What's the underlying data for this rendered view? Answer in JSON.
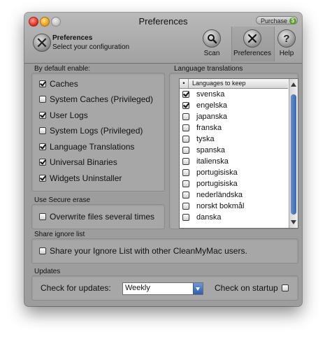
{
  "window": {
    "title": "Preferences",
    "purchase_label": "Purchase",
    "purchase_badge": "$"
  },
  "header": {
    "title": "Preferences",
    "subtitle": "Select your configuration"
  },
  "toolbar": {
    "scan_label": "Scan",
    "preferences_label": "Preferences",
    "help_label": "Help"
  },
  "defaults": {
    "heading": "By default enable:",
    "options": [
      {
        "label": "Caches",
        "checked": true
      },
      {
        "label": "System Caches (Privileged)",
        "checked": false
      },
      {
        "label": "User Logs",
        "checked": true
      },
      {
        "label": "System Logs (Privileged)",
        "checked": false
      },
      {
        "label": "Language Translations",
        "checked": true
      },
      {
        "label": "Universal Binaries",
        "checked": true
      },
      {
        "label": "Widgets Uninstaller",
        "checked": true
      }
    ]
  },
  "languages": {
    "heading": "Language translations",
    "column_bullet": "•",
    "column_header": "Languages to keep",
    "items": [
      {
        "label": "svenska",
        "checked": true
      },
      {
        "label": "engelska",
        "checked": true
      },
      {
        "label": "japanska",
        "checked": false
      },
      {
        "label": "franska",
        "checked": false
      },
      {
        "label": "tyska",
        "checked": false
      },
      {
        "label": "spanska",
        "checked": false
      },
      {
        "label": "italienska",
        "checked": false
      },
      {
        "label": "portugisiska",
        "checked": false
      },
      {
        "label": "portugisiska",
        "checked": false
      },
      {
        "label": "nederländska",
        "checked": false
      },
      {
        "label": "norskt bokmål",
        "checked": false
      },
      {
        "label": "danska",
        "checked": false
      }
    ]
  },
  "secure_erase": {
    "heading": "Use Secure erase",
    "option": "Overwrite files several times",
    "checked": false
  },
  "ignore_list": {
    "heading": "Share ignore list",
    "option": "Share your Ignore List with other CleanMyMac users.",
    "checked": false
  },
  "updates": {
    "heading": "Updates",
    "check_label": "Check for updates:",
    "frequency": "Weekly",
    "startup_label": "Check on startup",
    "startup_checked": false
  }
}
